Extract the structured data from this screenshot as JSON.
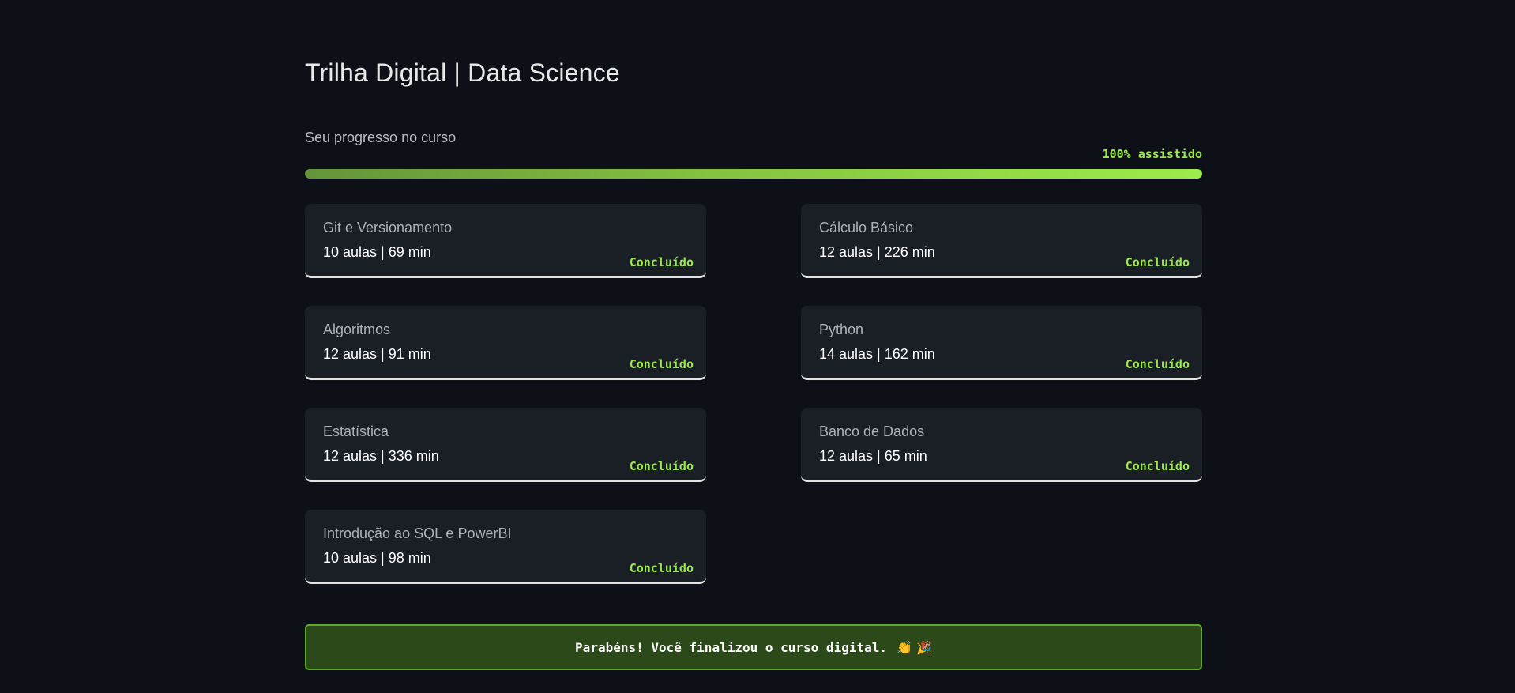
{
  "header": {
    "title": "Trilha Digital | Data Science"
  },
  "progress": {
    "label": "Seu progresso no curso",
    "value_text": "100% assistido",
    "fraction": 1.0
  },
  "modules": [
    {
      "name": "Git e Versionamento",
      "meta": "10 aulas | 69 min",
      "status": "Concluído"
    },
    {
      "name": "Cálculo Básico",
      "meta": "12 aulas | 226 min",
      "status": "Concluído"
    },
    {
      "name": "Algoritmos",
      "meta": "12 aulas | 91 min",
      "status": "Concluído"
    },
    {
      "name": "Python",
      "meta": "14 aulas | 162 min",
      "status": "Concluído"
    },
    {
      "name": "Estatística",
      "meta": "12 aulas | 336 min",
      "status": "Concluído"
    },
    {
      "name": "Banco de Dados",
      "meta": "12 aulas | 65 min",
      "status": "Concluído"
    },
    {
      "name": "Introdução ao SQL e PowerBI",
      "meta": "10 aulas | 98 min",
      "status": "Concluído"
    }
  ],
  "banner": {
    "message": "Parabéns! Você finalizou o curso digital.",
    "emoji": "👏 🎉"
  },
  "colors": {
    "background": "#0d1117",
    "card": "#1a1e25",
    "accent": "#9be84a",
    "banner_bg": "#2c4a19",
    "banner_border": "#5ea82b"
  }
}
